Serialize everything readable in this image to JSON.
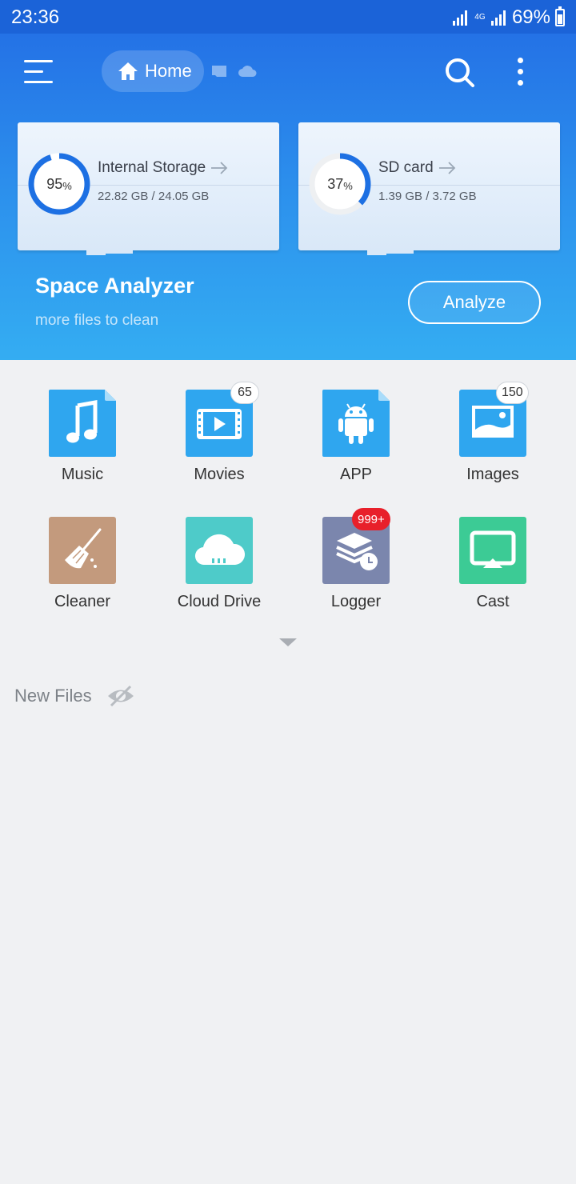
{
  "status_bar": {
    "time": "23:36",
    "network": "4G",
    "battery": "69%"
  },
  "header": {
    "menu_icon": "menu-icon",
    "home_label": "Home",
    "search_icon": "search-icon",
    "more_icon": "more-vert-icon"
  },
  "storage": [
    {
      "name": "Internal Storage",
      "percent_label": "95",
      "percent_symbol": "%",
      "used_fraction": 0.95,
      "size": "22.82 GB / 24.05 GB"
    },
    {
      "name": "SD card",
      "percent_label": "37",
      "percent_symbol": "%",
      "used_fraction": 0.37,
      "size": "1.39 GB / 3.72 GB"
    }
  ],
  "space_analyzer": {
    "title": "Space Analyzer",
    "subtitle": "more files to clean",
    "button": "Analyze"
  },
  "categories": [
    {
      "label": "Music",
      "icon": "music-icon",
      "color": "#2fa6ef"
    },
    {
      "label": "Movies",
      "icon": "movie-icon",
      "color": "#2fa6ef",
      "badge": "65"
    },
    {
      "label": "APP",
      "icon": "android-icon",
      "color": "#2fa6ef"
    },
    {
      "label": "Images",
      "icon": "image-icon",
      "color": "#2fa6ef",
      "badge": "150"
    },
    {
      "label": "Cleaner",
      "icon": "broom-icon",
      "color": "#c39a7d"
    },
    {
      "label": "Cloud Drive",
      "icon": "cloud-icon",
      "color": "#4ecbc9"
    },
    {
      "label": "Logger",
      "icon": "logger-icon",
      "color": "#7b86ad",
      "badge": "999+"
    },
    {
      "label": "Cast",
      "icon": "cast-icon",
      "color": "#3ccb95"
    }
  ],
  "new_files": {
    "label": "New Files"
  }
}
